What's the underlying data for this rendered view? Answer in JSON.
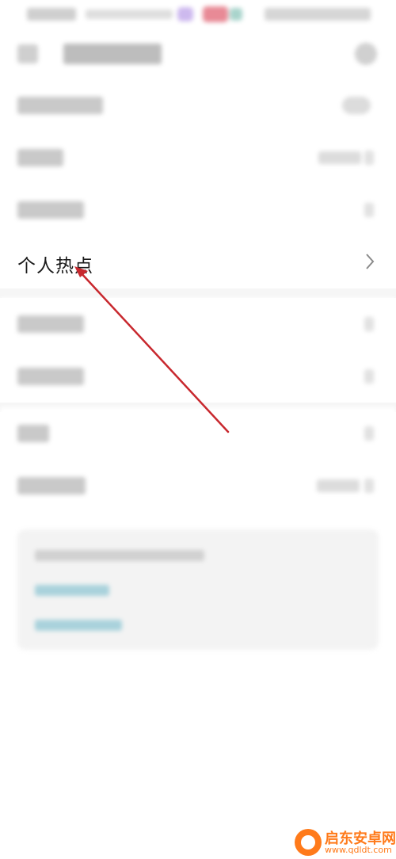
{
  "list": {
    "hotspot": {
      "label": "个人热点"
    }
  },
  "watermark": {
    "name": "启东安卓网",
    "url": "www.qdldt.com"
  },
  "colors": {
    "annotation_arrow": "#c8282e",
    "watermark": "#ff7a1a",
    "link_placeholder": "#a9d2dc"
  }
}
